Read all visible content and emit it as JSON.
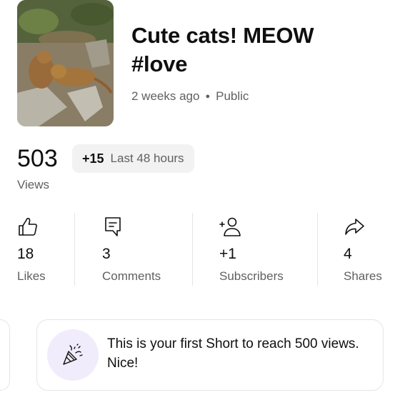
{
  "video": {
    "title": "Cute cats! MEOW #love",
    "age": "2 weeks ago",
    "visibility": "Public",
    "thumbnail_icon": "cat-photo-thumbnail"
  },
  "views": {
    "count": "503",
    "label": "Views",
    "delta_value": "+15",
    "delta_label": "Last 48 hours"
  },
  "stats": [
    {
      "icon": "thumbs-up-icon",
      "value": "18",
      "label": "Likes"
    },
    {
      "icon": "comment-icon",
      "value": "3",
      "label": "Comments"
    },
    {
      "icon": "person-add-icon",
      "value": "+1",
      "label": "Subscribers"
    },
    {
      "icon": "share-icon",
      "value": "4",
      "label": "Shares"
    }
  ],
  "milestone": {
    "icon": "party-popper-icon",
    "text": "This is your first Short to reach 500 views. Nice!"
  },
  "colors": {
    "primary_text": "#0f0f0f",
    "secondary_text": "#606060",
    "chip_bg": "#f2f2f2",
    "divider": "#e5e5e5",
    "milestone_icon_bg": "#f1ecfb"
  }
}
